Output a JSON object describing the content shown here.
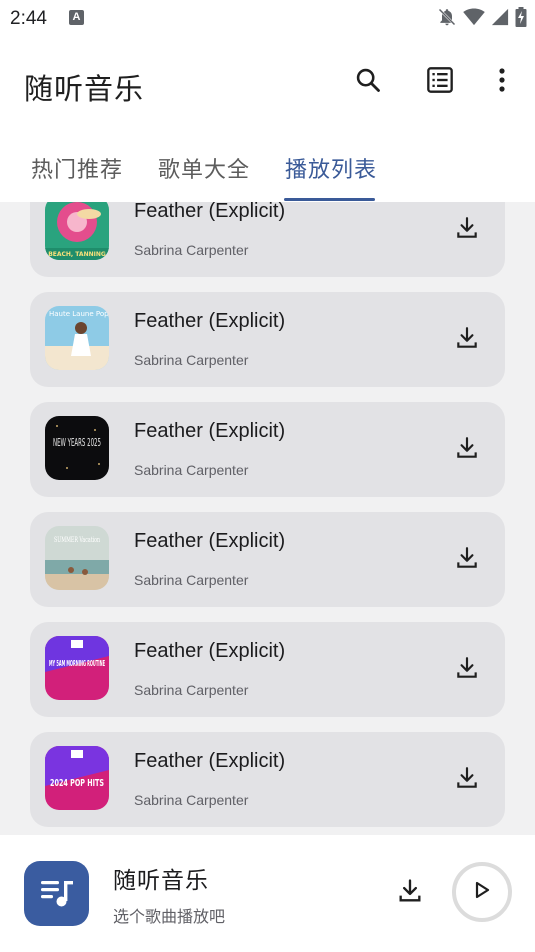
{
  "status_bar": {
    "time": "2:44",
    "notification_badge": "A",
    "icons": [
      "notifications-off-icon",
      "wifi-icon",
      "cell-signal-icon",
      "battery-charging-icon"
    ]
  },
  "app_bar": {
    "title": "随听音乐",
    "actions": [
      "search-icon",
      "playlist-icon",
      "more-vert-icon"
    ]
  },
  "tabs": [
    {
      "label": "热门推荐",
      "active": false
    },
    {
      "label": "歌单大全",
      "active": false
    },
    {
      "label": "播放列表",
      "active": true
    }
  ],
  "playlist": {
    "items": [
      {
        "title": "Feather (Explicit)",
        "artist": "Sabrina Carpenter",
        "cover": "beach-cover",
        "cover_text": "BEACH, TANNING"
      },
      {
        "title": "Feather (Explicit)",
        "artist": "Sabrina Carpenter",
        "cover": "pop-cover",
        "cover_text": "Haute Laune Pop"
      },
      {
        "title": "Feather (Explicit)",
        "artist": "Sabrina Carpenter",
        "cover": "new-years-cover",
        "cover_text": "NEW YEARS 2025"
      },
      {
        "title": "Feather (Explicit)",
        "artist": "Sabrina Carpenter",
        "cover": "summer-cover",
        "cover_text": "SUMMER Vacation"
      },
      {
        "title": "Feather (Explicit)",
        "artist": "Sabrina Carpenter",
        "cover": "morning-cover",
        "cover_text": "MY 5AM MORNING ROUTINE"
      },
      {
        "title": "Feather (Explicit)",
        "artist": "Sabrina Carpenter",
        "cover": "pop-hits-cover",
        "cover_text": "2024 POP HITS"
      }
    ]
  },
  "player": {
    "title": "随听音乐",
    "subtitle": "选个歌曲播放吧",
    "icons": [
      "music-note-icon",
      "download-icon",
      "play-icon"
    ]
  },
  "colors": {
    "accent": "#3a5a98",
    "card_bg": "#e2e2e5",
    "list_bg": "#f1f1f2",
    "player_art": "#3a5ca0"
  }
}
